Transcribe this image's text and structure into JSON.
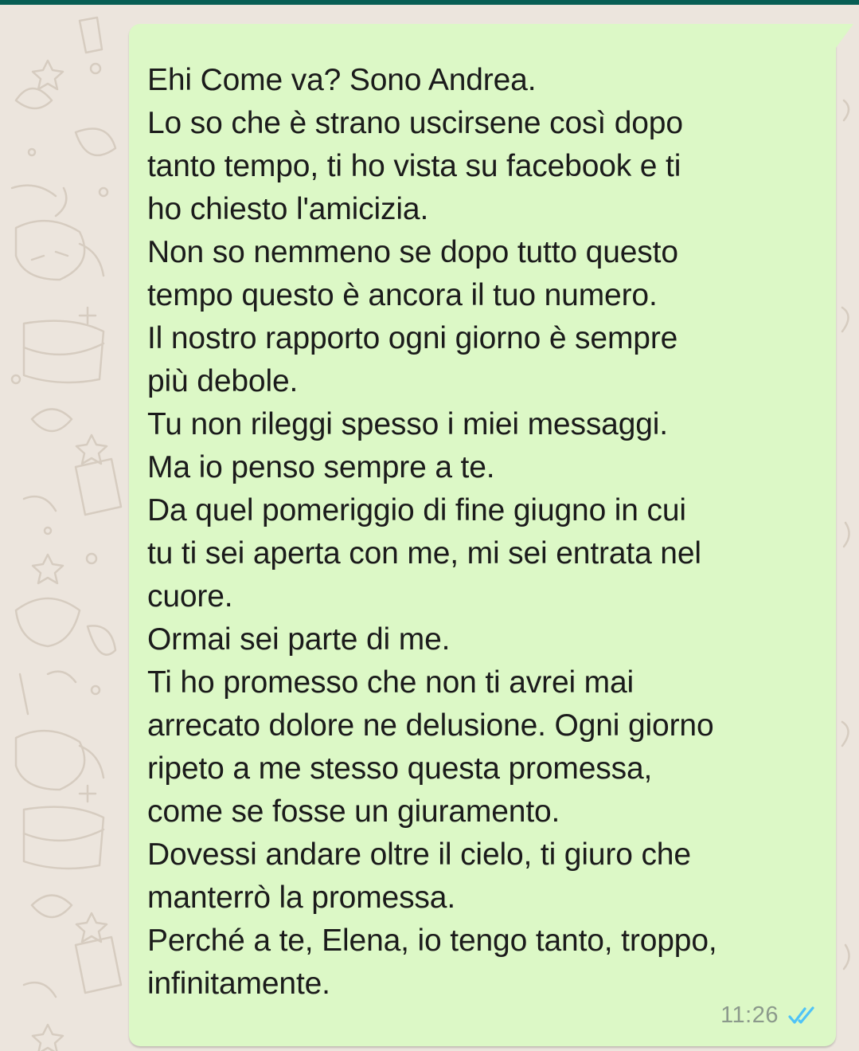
{
  "colors": {
    "bubble_bg": "#dcf8c6",
    "wallpaper_bg": "#ece5dd",
    "read_tick": "#4fc3f7",
    "timestamp": "#8c9a8c"
  },
  "message": {
    "lines": [
      "Ehi Come va? Sono Andrea.",
      "Lo so che è strano uscirsene così dopo",
      "tanto tempo, ti ho vista su facebook e ti",
      "ho chiesto l'amicizia.",
      "Non so nemmeno se dopo tutto questo",
      "tempo questo è ancora il tuo numero.",
      "Il nostro rapporto ogni giorno è sempre",
      "più debole.",
      "Tu non rileggi spesso i miei messaggi.",
      "Ma io penso sempre a te.",
      "Da quel pomeriggio di fine giugno in cui",
      "tu ti sei aperta con me, mi sei entrata nel",
      "cuore.",
      "Ormai sei parte di me.",
      "Ti ho promesso che non ti avrei mai",
      "arrecato dolore ne delusione. Ogni giorno",
      "ripeto a me stesso questa promessa,",
      "come se fosse un giuramento.",
      "Dovessi andare oltre il cielo, ti giuro che",
      "manterrò la promessa.",
      "Perché a te, Elena, io tengo tanto, troppo,",
      "infinitamente."
    ],
    "time": "11:26",
    "status_icon": "double-check-read-icon"
  }
}
